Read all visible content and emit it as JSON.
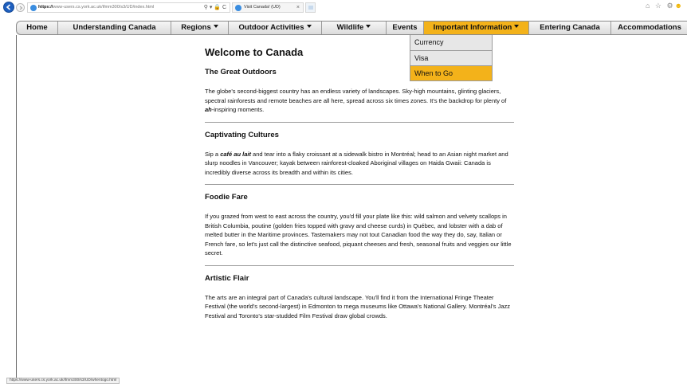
{
  "browser": {
    "url_prefix": "https://",
    "url_domain": "www-users.cs.york.ac.uk",
    "url_path": "/ifmm300/s3/UD/index.html",
    "address_icons": "⚲ ▾ 🔒 C",
    "tab_title": "Visit Canada! (UD)",
    "tab_close": "×",
    "right_icons": "⌂ ☆ ⚙",
    "smiley": "☻"
  },
  "nav": {
    "items": [
      {
        "label": "Home"
      },
      {
        "label": "Understanding Canada"
      },
      {
        "label": "Regions"
      },
      {
        "label": "Outdoor Activities"
      },
      {
        "label": "Wildlife"
      },
      {
        "label": "Events"
      },
      {
        "label": "Important Information"
      },
      {
        "label": "Entering Canada"
      },
      {
        "label": "Accommodations"
      }
    ],
    "active": "Important Information"
  },
  "dropdown": {
    "items": [
      "Currency",
      "Visa",
      "When to Go"
    ],
    "highlighted": "When to Go"
  },
  "main": {
    "title": "Welcome to Canada",
    "sections": [
      {
        "heading": "The Great Outdoors",
        "text_before": "The globe's second-biggest country has an endless variety of landscapes. Sky-high mountains, glinting glaciers, spectral rainforests and remote beaches are all here, spread across six times zones. It's the backdrop for plenty of ",
        "emphasis": "ah",
        "text_after": "-inspiring moments."
      },
      {
        "heading": "Captivating Cultures",
        "text_before": "Sip a ",
        "emphasis": "café au lait",
        "text_after": " and tear into a flaky croissant at a sidewalk bistro in Montréal; head to an Asian night market and slurp noodles in Vancouver; kayak between rainforest-cloaked Aboriginal villages on Haida Gwaii: Canada is incredibly diverse across its breadth and within its cities."
      },
      {
        "heading": "Foodie Fare",
        "text_before": "If you grazed from west to east across the country, you'd fill your plate like this: wild salmon and velvety scallops in British Columbia, poutine (golden fries topped with gravy and cheese curds) in Québec, and lobster with a dab of melted butter in the Maritime provinces. Tastemakers may not tout Canadian food the way they do, say, Italian or French fare, so let's just call the distinctive seafood, piquant cheeses and fresh, seasonal fruits and veggies our little secret.",
        "emphasis": "",
        "text_after": ""
      },
      {
        "heading": "Artistic Flair",
        "text_before": "The arts are an integral part of Canada's cultural landscape. You'll find it from the International Fringe Theater Festival (the world's second-largest) in Edmonton to mega museums like Ottawa's National Gallery. Montréal's Jazz Festival and Toronto's star-studded Film Festival draw global crowds.",
        "emphasis": "",
        "text_after": ""
      }
    ]
  },
  "status_bar": {
    "text": "https://www-users.cs.york.ac.uk/ifmm300/s3/UD/whentogo.html"
  }
}
